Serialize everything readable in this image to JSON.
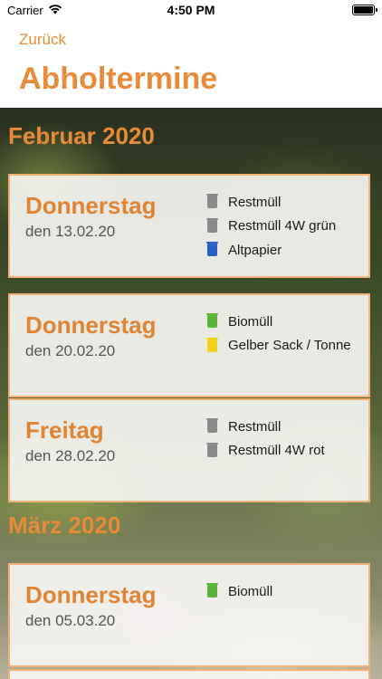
{
  "status_bar": {
    "carrier": "Carrier",
    "time": "4:50 PM"
  },
  "nav": {
    "back_label": "Zurück",
    "title": "Abholtermine"
  },
  "colors": {
    "accent": "#e88c3a",
    "bin_gray": "#8a8a8a",
    "bin_blue": "#2a5fc8",
    "bin_green": "#5ab33a",
    "bin_yellow": "#f0d21c"
  },
  "months": [
    {
      "label": "Februar 2020"
    },
    {
      "label": "März 2020"
    }
  ],
  "cards": [
    {
      "day": "Donnerstag",
      "date": "den 13.02.20",
      "items": [
        {
          "label": "Restmüll",
          "icon": "trash-bin-icon",
          "color": "#8a8a8a"
        },
        {
          "label": "Restmüll 4W grün",
          "icon": "trash-bin-icon",
          "color": "#8a8a8a"
        },
        {
          "label": "Altpapier",
          "icon": "trash-bin-icon",
          "color": "#2a5fc8"
        }
      ]
    },
    {
      "day": "Donnerstag",
      "date": "den 20.02.20",
      "items": [
        {
          "label": "Biomüll",
          "icon": "trash-bin-icon",
          "color": "#5ab33a"
        },
        {
          "label": "Gelber Sack / Tonne",
          "icon": "trash-bin-icon",
          "color": "#f0d21c"
        }
      ]
    },
    {
      "day": "Freitag",
      "date": "den 28.02.20",
      "items": [
        {
          "label": "Restmüll",
          "icon": "trash-bin-icon",
          "color": "#8a8a8a"
        },
        {
          "label": "Restmüll 4W rot",
          "icon": "trash-bin-icon",
          "color": "#8a8a8a"
        }
      ]
    },
    {
      "day": "Donnerstag",
      "date": "den 05.03.20",
      "items": [
        {
          "label": "Biomüll",
          "icon": "trash-bin-icon",
          "color": "#5ab33a"
        }
      ]
    }
  ]
}
